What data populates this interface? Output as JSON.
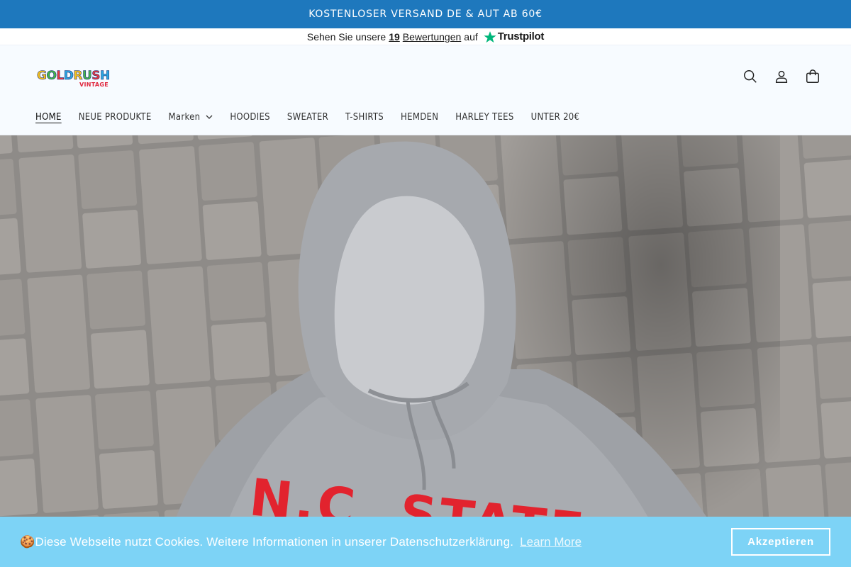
{
  "announcement": "KOSTENLOSER VERSAND DE & AUT AB 60€",
  "trustpilot": {
    "prefix": "Sehen Sie unsere",
    "count": "19",
    "reviews": "Bewertungen",
    "on": "auf",
    "brand": "Trustpilot",
    "star_color": "#00b67a"
  },
  "logo": {
    "line1": "GOLDRUSH",
    "line2": "VINTAGE",
    "colors": [
      "#f7c21b",
      "#44b649",
      "#e8383d",
      "#2ea7e0",
      "#f7c21b",
      "#44b649",
      "#e8383d",
      "#2ea7e0"
    ]
  },
  "header_icons": [
    "search-icon",
    "account-icon",
    "cart-icon"
  ],
  "nav": {
    "items": [
      {
        "label": "HOME",
        "active": true
      },
      {
        "label": "NEUE PRODUKTE"
      },
      {
        "label": "Marken",
        "dropdown": true
      },
      {
        "label": "HOODIES"
      },
      {
        "label": "SWEATER"
      },
      {
        "label": "T-SHIRTS"
      },
      {
        "label": "HEMDEN"
      },
      {
        "label": "HARLEY TEES"
      },
      {
        "label": "UNTER 20€"
      }
    ]
  },
  "hero": {
    "print_text": "N.C. STATE",
    "print_color": "#e2232e"
  },
  "cookie": {
    "icon": "cookie-icon",
    "message": "Diese Webseite nutzt Cookies. Weitere Informationen in unserer Datenschutzerklärung.",
    "learn_more": "Learn More",
    "accept": "Akzeptieren"
  },
  "colors": {
    "announcement_bg": "#1e78bd",
    "cookie_bg": "#7dd3f6"
  }
}
